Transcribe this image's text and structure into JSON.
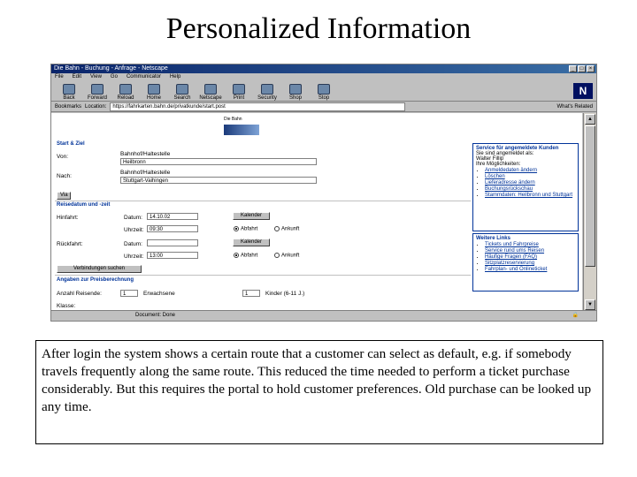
{
  "slide": {
    "title": "Personalized Information",
    "caption": "After login the system shows a certain route that a customer can select as default, e.g. if somebody travels frequently along the same route. This reduced the time needed to perform a ticket purchase considerably. But this requires the portal to hold customer preferences. Old purchase can be looked up any time."
  },
  "browser": {
    "title": "Die Bahn - Buchung - Anfrage - Netscape",
    "menu": [
      "File",
      "Edit",
      "View",
      "Go",
      "Communicator",
      "Help"
    ],
    "toolbar": [
      {
        "label": "Back",
        "icon": "back-icon"
      },
      {
        "label": "Forward",
        "icon": "forward-icon"
      },
      {
        "label": "Reload",
        "icon": "reload-icon"
      },
      {
        "label": "Home",
        "icon": "home-icon"
      },
      {
        "label": "Search",
        "icon": "search-icon"
      },
      {
        "label": "Netscape",
        "icon": "netscape-icon"
      },
      {
        "label": "Print",
        "icon": "print-icon"
      },
      {
        "label": "Security",
        "icon": "security-icon"
      },
      {
        "label": "Shop",
        "icon": "shop-icon"
      },
      {
        "label": "Stop",
        "icon": "stop-icon"
      }
    ],
    "bookmarks_label": "Bookmarks",
    "location_label": "Location:",
    "location_value": "https://fahrkarten.bahn.de/privatkunde/start.post",
    "related_label": "What's Related",
    "status_text": "Document: Done"
  },
  "form": {
    "logo_text": "Die Bahn",
    "start_ziel_header": "Start & Ziel",
    "von_label": "Von:",
    "von_hint": "Bahnhof/Haltestelle",
    "von_value": "Heilbronn",
    "nach_label": "Nach:",
    "nach_hint": "Bahnhof/Haltestelle",
    "nach_value": "Stuttgart-Vaihingen",
    "via_button": "Via",
    "reisedatum_header": "Reisedatum und -zeit",
    "hinfahrt_label": "Hinfahrt:",
    "rueckfahrt_label": "Rückfahrt:",
    "datum_label": "Datum:",
    "uhrzeit_label": "Uhrzeit:",
    "hin_datum_value": "14.10.02",
    "hin_uhrzeit_value": "09:30",
    "rueck_uhrzeit_value": "13:00",
    "kalender_button": "Kalender",
    "kalender2_button": "Kalender",
    "abfahrt_label": "Abfahrt",
    "ankunft_label": "Ankunft",
    "verbindungen_button": "Verbindungen suchen",
    "preis_header": "Angaben zur Preisberechnung",
    "anzahl_label": "Anzahl Reisende:",
    "erwachsene_value": "1",
    "erwachsene_label": "Erwachsene",
    "kinder_value": "1",
    "kinder_label": "Kinder (6-11 J.)",
    "klasse_label": "Klasse:"
  },
  "sidebar": {
    "service_title": "Service für angemeldete Kunden",
    "service_line1": "Sie sind angemeldet als:",
    "service_line2": "Walter Fillip",
    "service_line3": "Ihre Möglichkeiten:",
    "service_items": [
      "Anmeldedaten ändern",
      "Löschen",
      "Lieferadresse ändern",
      "Buchungsrückschau",
      "Stammdaten: Heilbronn und Stuttgart"
    ],
    "links_title": "Weitere Links",
    "links_items": [
      "Tickets und Fahrpreise",
      "Service rund ums Reisen",
      "Häufige Fragen (FAQ)",
      "Sitzplatzreservierung",
      "Fahrplan- und Onlineticket"
    ]
  }
}
